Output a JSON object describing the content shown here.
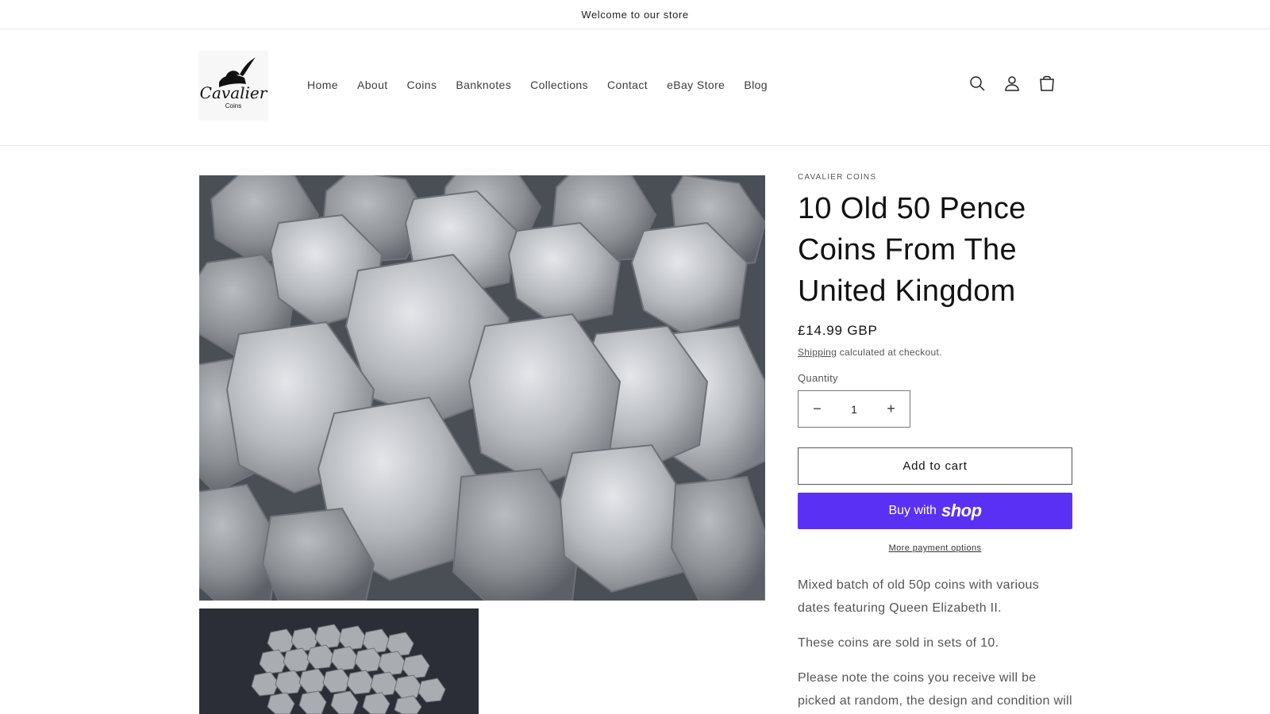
{
  "announcement": {
    "text": "Welcome to our store"
  },
  "header": {
    "logo": {
      "script_text": "Cavalier",
      "sub_text": "Coins"
    },
    "nav": [
      "Home",
      "About",
      "Coins",
      "Banknotes",
      "Collections",
      "Contact",
      "eBay Store",
      "Blog"
    ],
    "icons": [
      "search-icon",
      "account-icon",
      "cart-icon"
    ]
  },
  "product": {
    "vendor": "CAVALIER COINS",
    "title": "10 Old 50 Pence Coins From The United Kingdom",
    "price": "£14.99 GBP",
    "shipping_link": "Shipping",
    "shipping_suffix": " calculated at checkout.",
    "quantity_label": "Quantity",
    "quantity_value": "1",
    "decrease_symbol": "−",
    "increase_symbol": "+",
    "add_to_cart": "Add to cart",
    "buy_with": "Buy with",
    "shop_word": "shop",
    "more_payment": "More payment options",
    "description": [
      "Mixed batch of old 50p coins with various dates featuring Queen Elizabeth II.",
      "These coins are sold in sets of 10.",
      "Please note the coins you receive will be picked at random, the design and condition will vary."
    ]
  },
  "colors": {
    "shop_pay": "#5a31f4",
    "text": "#121212",
    "muted": "#555555",
    "border": "#e6e6e6"
  }
}
